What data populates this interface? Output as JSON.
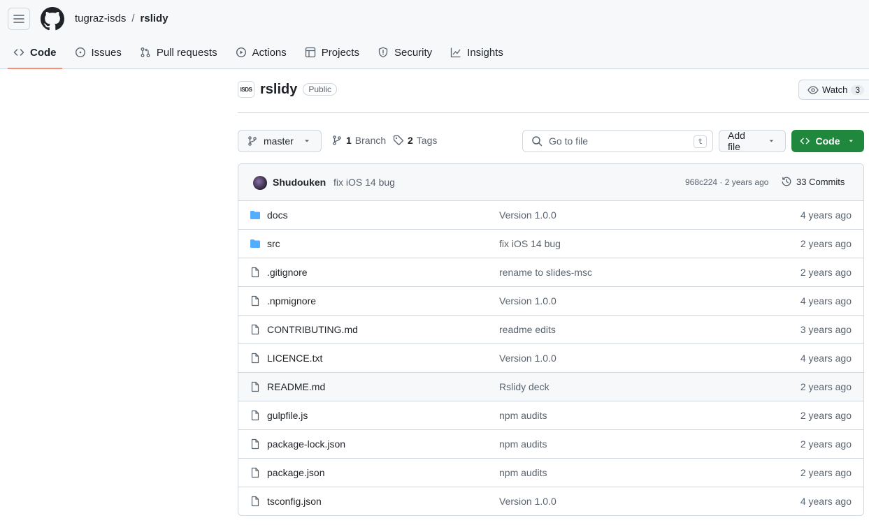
{
  "header": {
    "owner": "tugraz-isds",
    "separator": "/",
    "repo": "rslidy"
  },
  "tabs": [
    {
      "label": "Code",
      "icon": "code-icon",
      "active": true
    },
    {
      "label": "Issues",
      "icon": "issue-icon"
    },
    {
      "label": "Pull requests",
      "icon": "pull-request-icon"
    },
    {
      "label": "Actions",
      "icon": "play-icon"
    },
    {
      "label": "Projects",
      "icon": "table-icon"
    },
    {
      "label": "Security",
      "icon": "shield-icon"
    },
    {
      "label": "Insights",
      "icon": "graph-icon"
    }
  ],
  "repo": {
    "avatar_text": "ISDS",
    "name": "rslidy",
    "visibility": "Public",
    "watch_label": "Watch",
    "watch_count": "3"
  },
  "toolbar": {
    "branch": "master",
    "branch_count": "1",
    "branch_label": "Branch",
    "tag_count": "2",
    "tag_label": "Tags",
    "goto_placeholder": "Go to file",
    "goto_kbd": "t",
    "add_file_label": "Add file",
    "code_label": "Code"
  },
  "commit": {
    "author": "Shudouken",
    "message": "fix iOS 14 bug",
    "meta": "968c224 · 2 years ago",
    "commits_label": "33 Commits"
  },
  "files": [
    {
      "name": "docs",
      "type": "folder",
      "message": "Version 1.0.0",
      "age": "4 years ago"
    },
    {
      "name": "src",
      "type": "folder",
      "message": "fix iOS 14 bug",
      "age": "2 years ago"
    },
    {
      "name": ".gitignore",
      "type": "file",
      "message": "rename to slides-msc",
      "age": "2 years ago"
    },
    {
      "name": ".npmignore",
      "type": "file",
      "message": "Version 1.0.0",
      "age": "4 years ago"
    },
    {
      "name": "CONTRIBUTING.md",
      "type": "file",
      "message": "readme edits",
      "age": "3 years ago"
    },
    {
      "name": "LICENCE.txt",
      "type": "file",
      "message": "Version 1.0.0",
      "age": "4 years ago"
    },
    {
      "name": "README.md",
      "type": "file",
      "message": "Rslidy deck",
      "age": "2 years ago"
    },
    {
      "name": "gulpfile.js",
      "type": "file",
      "message": "npm audits",
      "age": "2 years ago"
    },
    {
      "name": "package-lock.json",
      "type": "file",
      "message": "npm audits",
      "age": "2 years ago"
    },
    {
      "name": "package.json",
      "type": "file",
      "message": "npm audits",
      "age": "2 years ago"
    },
    {
      "name": "tsconfig.json",
      "type": "file",
      "message": "Version 1.0.0",
      "age": "4 years ago"
    }
  ],
  "colors": {
    "accent_green": "#1f883d",
    "tab_underline": "#fd8c73",
    "folder_blue": "#54aeff"
  }
}
